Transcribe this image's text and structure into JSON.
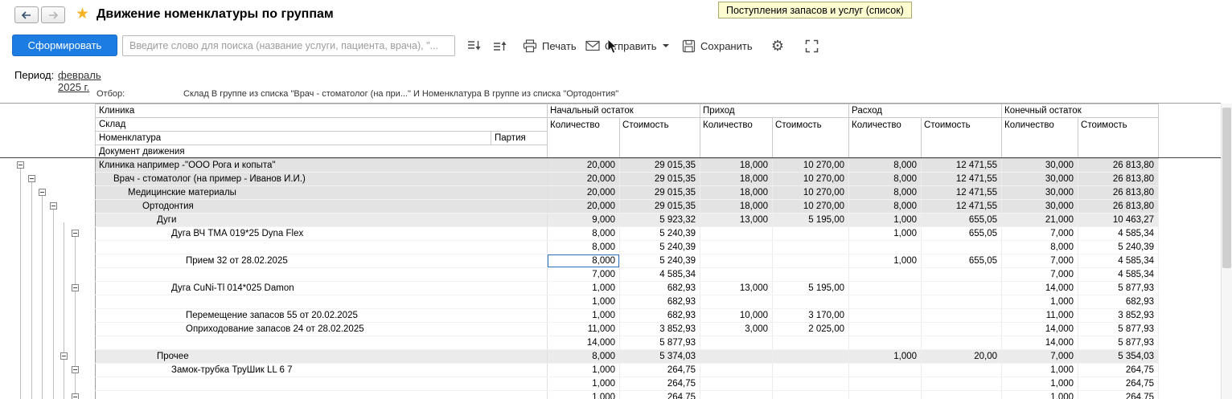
{
  "titlebar": {
    "title": "Движение номенклатуры по группам",
    "tooltip": "Поступления запасов и услуг (список)"
  },
  "toolbar": {
    "generate": "Сформировать",
    "search_placeholder": "Введите слово для поиска (название услуги, пациента, врача), \"...",
    "print": "Печать",
    "send": "Отправить",
    "save": "Сохранить"
  },
  "period": {
    "label": "Период:",
    "value": "февраль 2025 г."
  },
  "filter": {
    "label": "Отбор:",
    "value": "Склад В группе из списка \"Врач - стоматолог (на при...\" И Номенклатура В группе из списка \"Ортодонтия\""
  },
  "colors": {
    "accent_button": "#1d7ce2",
    "tooltip_bg": "#fdfbd0",
    "group_row": "#e3e3e3",
    "group_row_light": "#ebebeb",
    "selection_border": "#2e75c6",
    "star": "#f7b322"
  },
  "table": {
    "left_headers": [
      "Клиника",
      "Склад",
      "Номенклатура",
      "Документ движения"
    ],
    "party_header": "Партия",
    "groups": [
      "Начальный остаток",
      "Приход",
      "Расход",
      "Конечный остаток"
    ],
    "subcols": [
      "Количество",
      "Стоимость"
    ],
    "rows": [
      {
        "label": "Клиника например -\"ООО Рога и копыта\"",
        "level": 0,
        "shade": "g1",
        "values": [
          "20,000",
          "29 015,35",
          "18,000",
          "10 270,00",
          "8,000",
          "12 471,55",
          "30,000",
          "26 813,80"
        ]
      },
      {
        "label": "Врач - стоматолог (на пример - Иванов И.И.)",
        "level": 1,
        "shade": "g1",
        "values": [
          "20,000",
          "29 015,35",
          "18,000",
          "10 270,00",
          "8,000",
          "12 471,55",
          "30,000",
          "26 813,80"
        ]
      },
      {
        "label": "Медицинские материалы",
        "level": 2,
        "shade": "g1",
        "values": [
          "20,000",
          "29 015,35",
          "18,000",
          "10 270,00",
          "8,000",
          "12 471,55",
          "30,000",
          "26 813,80"
        ]
      },
      {
        "label": "Ортодонтия",
        "level": 3,
        "shade": "g1",
        "values": [
          "20,000",
          "29 015,35",
          "18,000",
          "10 270,00",
          "8,000",
          "12 471,55",
          "30,000",
          "26 813,80"
        ]
      },
      {
        "label": "Дуги",
        "level": 4,
        "shade": "g2",
        "values": [
          "9,000",
          "5 923,32",
          "13,000",
          "5 195,00",
          "1,000",
          "655,05",
          "21,000",
          "10 463,27"
        ]
      },
      {
        "label": "Дуга ВЧ ТМА 019*25 Dyna Flex",
        "level": 5,
        "shade": "",
        "values": [
          "8,000",
          "5 240,39",
          "",
          "",
          "1,000",
          "655,05",
          "7,000",
          "4 585,34"
        ]
      },
      {
        "label": "",
        "level": 6,
        "shade": "",
        "values": [
          "8,000",
          "5 240,39",
          "",
          "",
          "",
          "",
          "8,000",
          "5 240,39"
        ]
      },
      {
        "label": "Прием 32 от 28.02.2025",
        "level": 6,
        "shade": "",
        "selected_col": 0,
        "values": [
          "8,000",
          "5 240,39",
          "",
          "",
          "1,000",
          "655,05",
          "7,000",
          "4 585,34"
        ]
      },
      {
        "label": "",
        "level": 6,
        "shade": "",
        "values": [
          "7,000",
          "4 585,34",
          "",
          "",
          "",
          "",
          "7,000",
          "4 585,34"
        ]
      },
      {
        "label": "Дуга CuNi-Tl 014*025 Damon",
        "level": 5,
        "shade": "",
        "values": [
          "1,000",
          "682,93",
          "13,000",
          "5 195,00",
          "",
          "",
          "14,000",
          "5 877,93"
        ]
      },
      {
        "label": "",
        "level": 6,
        "shade": "",
        "values": [
          "1,000",
          "682,93",
          "",
          "",
          "",
          "",
          "1,000",
          "682,93"
        ]
      },
      {
        "label": "Перемещение запасов 55 от 20.02.2025",
        "level": 6,
        "shade": "",
        "values": [
          "1,000",
          "682,93",
          "10,000",
          "3 170,00",
          "",
          "",
          "11,000",
          "3 852,93"
        ]
      },
      {
        "label": "Оприходование запасов 24 от 28.02.2025",
        "level": 6,
        "shade": "",
        "values": [
          "11,000",
          "3 852,93",
          "3,000",
          "2 025,00",
          "",
          "",
          "14,000",
          "5 877,93"
        ]
      },
      {
        "label": "",
        "level": 6,
        "shade": "",
        "values": [
          "14,000",
          "5 877,93",
          "",
          "",
          "",
          "",
          "14,000",
          "5 877,93"
        ]
      },
      {
        "label": "Прочее",
        "level": 4,
        "shade": "g2",
        "values": [
          "8,000",
          "5 374,03",
          "",
          "",
          "1,000",
          "20,00",
          "7,000",
          "5 354,03"
        ]
      },
      {
        "label": "Замок-трубка ТруШик LL 6 7",
        "level": 5,
        "shade": "",
        "values": [
          "1,000",
          "264,75",
          "",
          "",
          "",
          "",
          "1,000",
          "264,75"
        ]
      },
      {
        "label": "",
        "level": 6,
        "shade": "",
        "values": [
          "1,000",
          "264,75",
          "",
          "",
          "",
          "",
          "1,000",
          "264,75"
        ]
      },
      {
        "label": "",
        "level": 6,
        "shade": "",
        "values": [
          "1,000",
          "264,75",
          "",
          "",
          "",
          "",
          "1,000",
          "264,75"
        ]
      }
    ],
    "expanders": [
      {
        "row": 0,
        "level": 0
      },
      {
        "row": 1,
        "level": 1
      },
      {
        "row": 2,
        "level": 2
      },
      {
        "row": 3,
        "level": 3
      },
      {
        "row": 5,
        "level": 5
      },
      {
        "row": 9,
        "level": 5
      },
      {
        "row": 14,
        "level": 4
      },
      {
        "row": 15,
        "level": 5
      },
      {
        "row": 17,
        "level": 5
      }
    ]
  }
}
